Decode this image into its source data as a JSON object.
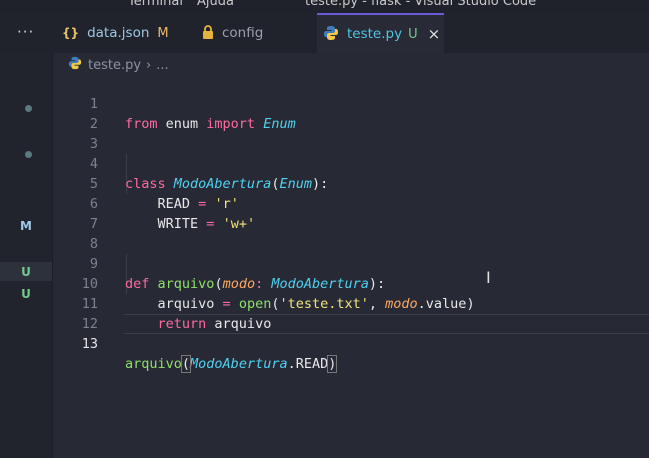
{
  "menu": {
    "items": [
      "Terminal",
      "Ajuda"
    ],
    "title": "teste.py - flask - Visual Studio Code"
  },
  "tabs": [
    {
      "icon": "{}",
      "label": "data.json",
      "badge": "M"
    },
    {
      "icon": "lock-icon",
      "label": "config",
      "badge": ""
    },
    {
      "icon": "python-icon",
      "label": "teste.py",
      "badge": "U",
      "close": "×"
    }
  ],
  "tab_more": "···",
  "breadcrumb": {
    "file": "teste.py",
    "sep": "›",
    "rest": "..."
  },
  "scm": {
    "markers": [
      "M",
      "U",
      "U"
    ]
  },
  "editor": {
    "line_numbers": [
      "1",
      "2",
      "3",
      "4",
      "5",
      "6",
      "7",
      "8",
      "9",
      "10",
      "11",
      "12",
      "13"
    ],
    "current_line": "13"
  },
  "colors": {
    "keyword": "#ff6a9d",
    "class": "#4fd1ef",
    "function": "#8ee06a",
    "string": "#f0e37a",
    "param": "#fca863",
    "accent": "#6b59d6"
  }
}
